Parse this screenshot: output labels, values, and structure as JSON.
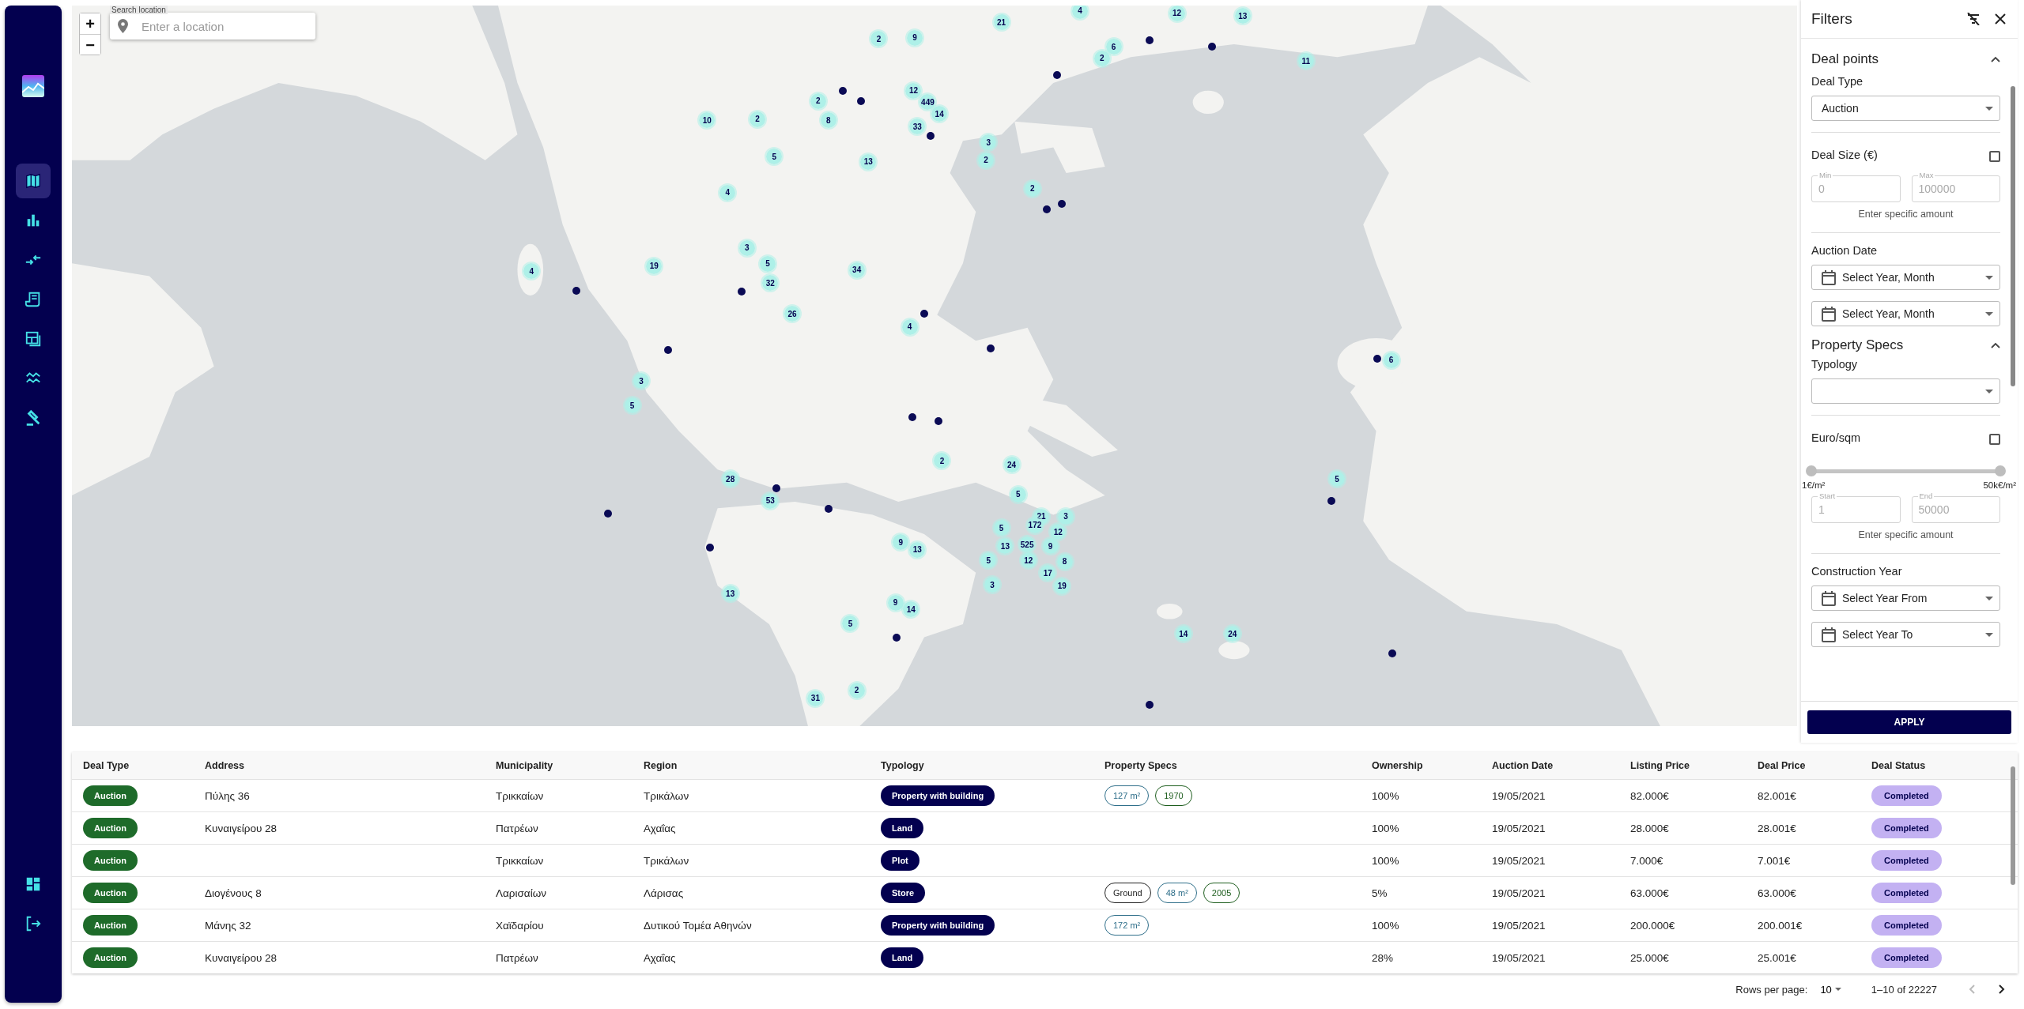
{
  "sidebar": {
    "nav": [
      {
        "selected": true
      },
      {
        "selected": false
      },
      {
        "selected": false
      },
      {
        "selected": false
      },
      {
        "selected": false
      },
      {
        "selected": false
      },
      {
        "selected": false
      }
    ]
  },
  "map": {
    "zoom_in": "+",
    "zoom_out": "−",
    "search": {
      "label": "Search location",
      "placeholder": "Enter a location"
    },
    "clusters": [
      {
        "count": "21"
      },
      {
        "count": "4"
      },
      {
        "count": "12"
      },
      {
        "count": "13"
      },
      {
        "count": "2"
      },
      {
        "count": "9"
      },
      {
        "count": "6"
      },
      {
        "count": "2"
      },
      {
        "count": "11"
      },
      {
        "count": "12"
      },
      {
        "count": "2"
      },
      {
        "count": "449"
      },
      {
        "count": "10"
      },
      {
        "count": "2"
      },
      {
        "count": "8"
      },
      {
        "count": "33"
      },
      {
        "count": "14"
      },
      {
        "count": "3"
      },
      {
        "count": "5"
      },
      {
        "count": "13"
      },
      {
        "count": "2"
      },
      {
        "count": "4"
      },
      {
        "count": "2"
      },
      {
        "count": "3"
      },
      {
        "count": "4"
      },
      {
        "count": "19"
      },
      {
        "count": "5"
      },
      {
        "count": "34"
      },
      {
        "count": "32"
      },
      {
        "count": "26"
      },
      {
        "count": "4"
      },
      {
        "count": "6"
      },
      {
        "count": "3"
      },
      {
        "count": "5"
      },
      {
        "count": "2"
      },
      {
        "count": "24"
      },
      {
        "count": "28"
      },
      {
        "count": "5"
      },
      {
        "count": "53"
      },
      {
        "count": "5"
      },
      {
        "count": "21"
      },
      {
        "count": "3"
      },
      {
        "count": "5"
      },
      {
        "count": "172"
      },
      {
        "count": "12"
      },
      {
        "count": "9"
      },
      {
        "count": "13"
      },
      {
        "count": "13"
      },
      {
        "count": "525"
      },
      {
        "count": "9"
      },
      {
        "count": "5"
      },
      {
        "count": "12"
      },
      {
        "count": "17"
      },
      {
        "count": "8"
      },
      {
        "count": "3"
      },
      {
        "count": "19"
      },
      {
        "count": "13"
      },
      {
        "count": "9"
      },
      {
        "count": "14"
      },
      {
        "count": "5"
      },
      {
        "count": "14"
      },
      {
        "count": "24"
      },
      {
        "count": "31"
      },
      {
        "count": "2"
      }
    ]
  },
  "filters": {
    "title": "Filters",
    "deal_points": {
      "title": "Deal points",
      "expanded": true,
      "deal_type": {
        "label": "Deal Type",
        "value": "Auction"
      },
      "deal_size": {
        "label": "Deal Size (€)",
        "checked": false,
        "min": {
          "label": "Min",
          "value": "0"
        },
        "max": {
          "label": "Max",
          "value": "100000"
        },
        "hint": "Enter specific amount"
      },
      "auction_date": {
        "label": "Auction Date",
        "from": {
          "value": "Select Year, Month"
        },
        "to": {
          "value": "Select Year, Month"
        }
      }
    },
    "property_specs": {
      "title": "Property Specs",
      "expanded": true,
      "typology": {
        "label": "Typology"
      },
      "euro_sqm": {
        "label": "Euro/sqm",
        "checked": false,
        "level": 1,
        "min_label": "1€/m²",
        "max_label": "50k€/m²",
        "start": {
          "label": "Start",
          "value": "1"
        },
        "end": {
          "label": "End",
          "value": "50000"
        },
        "hint": "Enter specific amount"
      },
      "construction_year": {
        "label": "Construction Year",
        "from": {
          "value": "Select Year From"
        },
        "to": {
          "value": "Select Year To"
        }
      }
    },
    "apply": "APPLY"
  },
  "table": {
    "columns": [
      "Deal Type",
      "Address",
      "Municipality",
      "Region",
      "Typology",
      "Property Specs",
      "Ownership",
      "Auction Date",
      "Listing Price",
      "Deal Price",
      "Deal Status"
    ],
    "rows": [
      {
        "deal_type": "Auction",
        "address": "Πύλης 36",
        "municipality": "Τρικκαίων",
        "region": "Τρικάλων",
        "typology": "Property with building",
        "specs": [
          {
            "kind": "area",
            "text": "127 m²"
          },
          {
            "kind": "year",
            "text": "1970"
          }
        ],
        "ownership": "100%",
        "auction_date": "19/05/2021",
        "listing_price": "82.000€",
        "deal_price": "82.001€",
        "status": "Completed"
      },
      {
        "deal_type": "Auction",
        "address": "Κυναιγείρου 28",
        "municipality": "Πατρέων",
        "region": "Αχαΐας",
        "typology": "Land",
        "specs": [],
        "ownership": "100%",
        "auction_date": "19/05/2021",
        "listing_price": "28.000€",
        "deal_price": "28.001€",
        "status": "Completed"
      },
      {
        "deal_type": "Auction",
        "municipality": "Τρικκαίων",
        "region": "Τρικάλων",
        "typology": "Plot",
        "specs": [],
        "ownership": "100%",
        "auction_date": "19/05/2021",
        "listing_price": "7.000€",
        "deal_price": "7.001€",
        "status": "Completed"
      },
      {
        "deal_type": "Auction",
        "address": "Διογένους 8",
        "municipality": "Λαρισαίων",
        "region": "Λάρισας",
        "typology": "Store",
        "specs": [
          {
            "kind": "floor",
            "text": "Ground"
          },
          {
            "kind": "area",
            "text": "48 m²"
          },
          {
            "kind": "year",
            "text": "2005"
          }
        ],
        "ownership": "5%",
        "auction_date": "19/05/2021",
        "listing_price": "63.000€",
        "deal_price": "63.000€",
        "status": "Completed"
      },
      {
        "deal_type": "Auction",
        "address": "Μάνης 32",
        "municipality": "Χαϊδαρίου",
        "region": "Δυτικού Τομέα Αθηνών",
        "typology": "Property with building",
        "specs": [
          {
            "kind": "area",
            "text": "172 m²"
          }
        ],
        "ownership": "100%",
        "auction_date": "19/05/2021",
        "listing_price": "200.000€",
        "deal_price": "200.001€",
        "status": "Completed"
      },
      {
        "deal_type": "Auction",
        "address": "Κυναιγείρου 28",
        "municipality": "Πατρέων",
        "region": "Αχαΐας",
        "typology": "Land",
        "specs": [],
        "ownership": "28%",
        "auction_date": "19/05/2021",
        "listing_price": "25.000€",
        "deal_price": "25.001€",
        "status": "Completed"
      }
    ]
  },
  "pagination": {
    "rows_per_page_label": "Rows per page:",
    "rows_per_page": "10",
    "range": "1–10 of 22227",
    "prev": {
      "disabled": true
    },
    "next": {
      "disabled": false
    }
  }
}
